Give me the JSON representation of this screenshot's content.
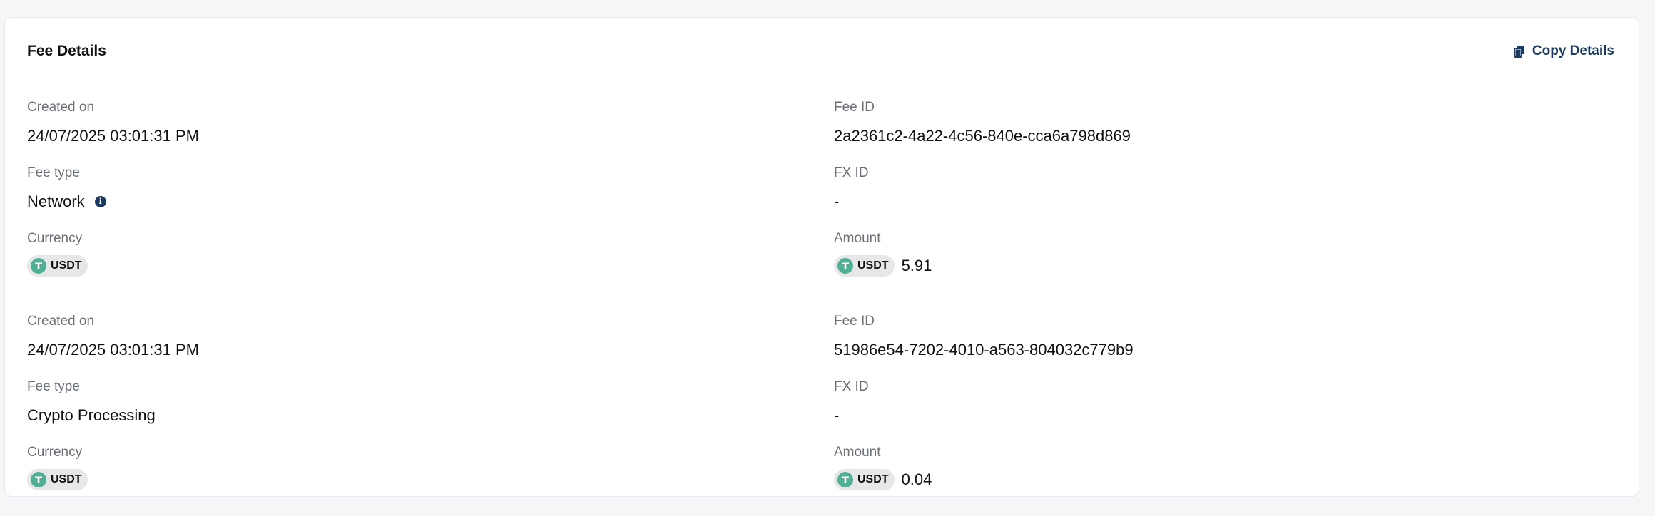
{
  "header": {
    "title": "Fee Details",
    "copy_label": "Copy Details"
  },
  "labels": {
    "created_on": "Created on",
    "fee_id": "Fee ID",
    "fee_type": "Fee type",
    "fx_id": "FX ID",
    "currency": "Currency",
    "amount": "Amount"
  },
  "fees": [
    {
      "created_on": "24/07/2025 03:01:31 PM",
      "fee_id": "2a2361c2-4a22-4c56-840e-cca6a798d869",
      "fee_type": "Network",
      "has_info_icon": true,
      "fx_id": "-",
      "currency": "USDT",
      "amount_currency": "USDT",
      "amount": "5.91"
    },
    {
      "created_on": "24/07/2025 03:01:31 PM",
      "fee_id": "51986e54-7202-4010-a563-804032c779b9",
      "fee_type": "Crypto Processing",
      "has_info_icon": false,
      "fx_id": "-",
      "currency": "USDT",
      "amount_currency": "USDT",
      "amount": "0.04"
    }
  ],
  "colors": {
    "accent": "#1d3b5e",
    "tether": "#50af95",
    "badge_bg": "#e6e7e9",
    "label": "#6b6f76"
  },
  "icons": {
    "copy": "copy-icon",
    "info": "info-icon",
    "currency": "tether-icon"
  }
}
